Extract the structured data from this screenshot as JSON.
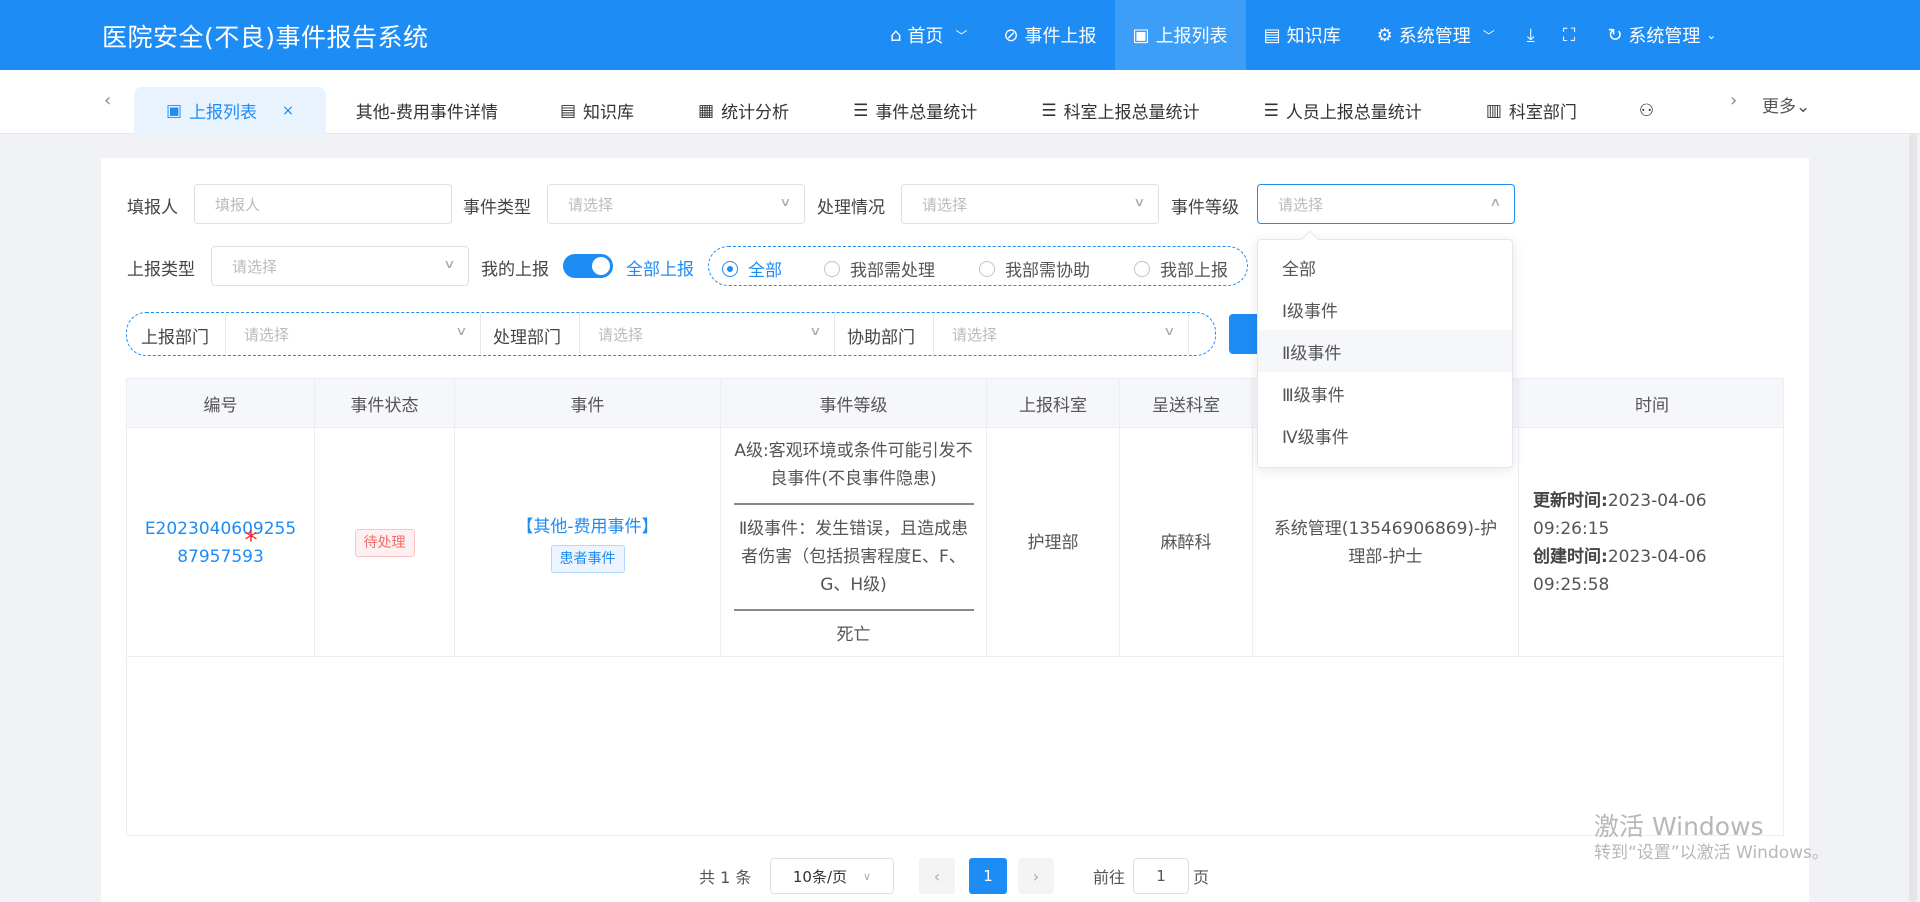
{
  "app": {
    "title": "医院安全(不良)事件报告系统"
  },
  "nav": {
    "home": "首页",
    "report": "事件上报",
    "list": "上报列表",
    "knowledge": "知识库",
    "system": "系统管理",
    "user": "系统管理"
  },
  "tabs": [
    "上报列表",
    "其他-费用事件详情",
    "知识库",
    "统计分析",
    "事件总量统计",
    "科室上报总量统计",
    "人员上报总量统计",
    "科室部门"
  ],
  "tabs_more": "更多",
  "filters": {
    "reporter_label": "填报人",
    "reporter_placeholder": "填报人",
    "event_type_label": "事件类型",
    "process_label": "处理情况",
    "level_label": "事件等级",
    "report_type_label": "上报类型",
    "placeholder": "请选择",
    "my_report_label": "我的上报",
    "all_report_label": "全部上报",
    "radios": [
      "全部",
      "我部需处理",
      "我部需协助",
      "我部上报"
    ],
    "report_dept_label": "上报部门",
    "handle_dept_label": "处理部门",
    "assist_dept_label": "协助部门"
  },
  "level_options": [
    "全部",
    "Ⅰ级事件",
    "Ⅱ级事件",
    "Ⅲ级事件",
    "Ⅳ级事件"
  ],
  "table": {
    "headers": [
      "编号",
      "事件状态",
      "事件",
      "事件等级",
      "上报科室",
      "呈送科室",
      "时间"
    ],
    "row": {
      "code": "E202304060925587957593",
      "star": "*",
      "status": "待处理",
      "event": "【其他-费用事件】",
      "event_tag": "患者事件",
      "level_a": "A级:客观环境或条件可能引发不良事件(不良事件隐患)",
      "level_b": "Ⅱ级事件：发生错误，且造成患者伤害（包括损害程度E、F、G、H级)",
      "level_c": "死亡",
      "report_dept": "护理部",
      "send_dept": "麻醉科",
      "handler": "系统管理(13546906869)-护理部-护士",
      "update_label": "更新时间:",
      "update_time": "2023-04-06 09:26:15",
      "create_label": "创建时间:",
      "create_time": "2023-04-06 09:25:58"
    }
  },
  "pagination": {
    "total": "共 1 条",
    "page_size": "10条/页",
    "current": "1",
    "goto_prefix": "前往",
    "goto_value": "1",
    "goto_suffix": "页"
  },
  "watermark": {
    "line1": "激活 Windows",
    "line2": "转到“设置”以激活 Windows。"
  }
}
